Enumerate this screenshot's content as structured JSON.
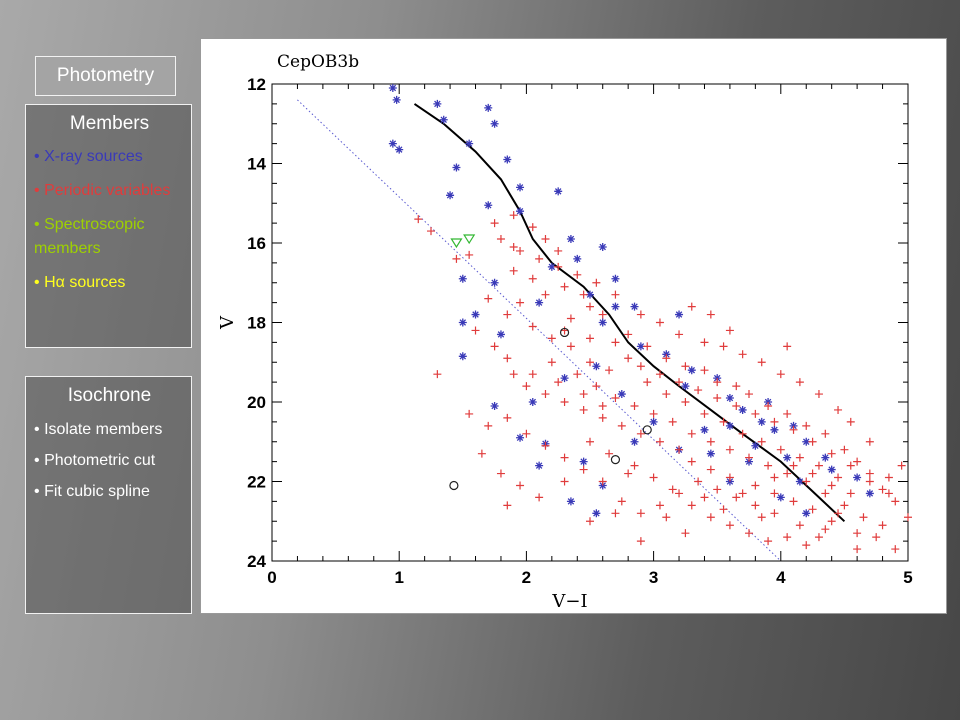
{
  "sidebar": {
    "photometry": "Photometry",
    "members": {
      "title": "Members",
      "items": [
        {
          "bullet": "•",
          "text": "X-ray sources",
          "color": "#3a3ab8"
        },
        {
          "bullet": "•",
          "text": "Periodic variables",
          "color": "#e03c3c"
        },
        {
          "bullet": "•",
          "text": "Spectroscopic members",
          "color": "#9ed100"
        },
        {
          "bullet": "•",
          "text": "Hα sources",
          "color": "#ffff1e"
        }
      ]
    },
    "isochrone": {
      "title": "Isochrone",
      "items": [
        {
          "bullet": "•",
          "text": "Isolate members"
        },
        {
          "bullet": "•",
          "text": "Photometric cut"
        },
        {
          "bullet": "•",
          "text": "Fit cubic spline"
        }
      ]
    }
  },
  "chart_data": {
    "type": "scatter",
    "title": "CepOB3b",
    "xlabel": "V−I",
    "ylabel": "V",
    "xlim": [
      0,
      5
    ],
    "ylim": [
      24,
      12
    ],
    "y_inverted": true,
    "x_ticks": [
      "0",
      "1",
      "2",
      "3",
      "4",
      "5"
    ],
    "y_ticks": [
      "12",
      "14",
      "16",
      "18",
      "20",
      "22",
      "24"
    ],
    "grid": false,
    "series": [
      {
        "marker": "asterisk",
        "color": "#3a3ab8",
        "points": [
          [
            0.95,
            12.1
          ],
          [
            0.98,
            12.4
          ],
          [
            0.95,
            13.5
          ],
          [
            1.0,
            13.65
          ],
          [
            1.3,
            12.5
          ],
          [
            1.35,
            12.9
          ],
          [
            1.45,
            14.1
          ],
          [
            1.7,
            12.6
          ],
          [
            1.75,
            13.0
          ],
          [
            1.55,
            13.5
          ],
          [
            1.85,
            13.9
          ],
          [
            1.95,
            14.6
          ],
          [
            1.4,
            14.8
          ],
          [
            1.7,
            15.05
          ],
          [
            1.95,
            15.2
          ],
          [
            2.25,
            14.7
          ],
          [
            2.35,
            15.9
          ],
          [
            2.4,
            16.4
          ],
          [
            2.6,
            16.1
          ],
          [
            2.7,
            16.9
          ],
          [
            2.2,
            16.6
          ],
          [
            1.75,
            17.0
          ],
          [
            1.5,
            16.9
          ],
          [
            1.6,
            17.8
          ],
          [
            1.8,
            18.3
          ],
          [
            1.5,
            18.0
          ],
          [
            1.5,
            18.85
          ],
          [
            2.1,
            17.5
          ],
          [
            2.5,
            17.3
          ],
          [
            2.7,
            17.6
          ],
          [
            2.85,
            17.6
          ],
          [
            3.2,
            17.8
          ],
          [
            2.6,
            18.0
          ],
          [
            2.9,
            18.6
          ],
          [
            3.1,
            18.8
          ],
          [
            3.3,
            19.2
          ],
          [
            3.5,
            19.4
          ],
          [
            3.6,
            19.9
          ],
          [
            3.7,
            20.2
          ],
          [
            3.85,
            20.5
          ],
          [
            3.95,
            20.7
          ],
          [
            4.1,
            20.6
          ],
          [
            4.2,
            21.0
          ],
          [
            4.35,
            21.4
          ],
          [
            3.6,
            20.6
          ],
          [
            3.4,
            20.7
          ],
          [
            3.8,
            21.1
          ],
          [
            4.05,
            21.4
          ],
          [
            3.2,
            21.2
          ],
          [
            3.0,
            20.5
          ],
          [
            2.75,
            19.8
          ],
          [
            2.55,
            19.1
          ],
          [
            2.3,
            19.4
          ],
          [
            2.05,
            20.0
          ],
          [
            1.95,
            20.9
          ],
          [
            2.1,
            21.6
          ],
          [
            2.45,
            21.5
          ],
          [
            2.6,
            22.1
          ],
          [
            2.35,
            22.5
          ],
          [
            2.55,
            22.8
          ],
          [
            3.45,
            21.3
          ],
          [
            3.6,
            22.0
          ],
          [
            3.75,
            21.5
          ],
          [
            4.0,
            22.4
          ],
          [
            4.15,
            22.0
          ],
          [
            4.4,
            21.7
          ],
          [
            4.6,
            21.9
          ],
          [
            4.7,
            22.3
          ],
          [
            4.2,
            22.8
          ],
          [
            2.85,
            21.0
          ],
          [
            2.15,
            21.05
          ],
          [
            3.25,
            19.6
          ],
          [
            3.9,
            20.0
          ],
          [
            1.75,
            20.1
          ]
        ]
      },
      {
        "marker": "plus",
        "color": "#e03c3c",
        "points": [
          [
            1.75,
            15.5
          ],
          [
            1.9,
            15.3
          ],
          [
            2.05,
            15.6
          ],
          [
            2.15,
            15.9
          ],
          [
            2.25,
            16.2
          ],
          [
            1.9,
            16.1
          ],
          [
            1.8,
            15.9
          ],
          [
            1.55,
            16.3
          ],
          [
            1.45,
            16.4
          ],
          [
            1.9,
            16.7
          ],
          [
            2.05,
            16.9
          ],
          [
            2.3,
            17.1
          ],
          [
            2.45,
            17.3
          ],
          [
            2.5,
            17.6
          ],
          [
            2.6,
            17.8
          ],
          [
            2.35,
            17.9
          ],
          [
            2.15,
            17.3
          ],
          [
            1.95,
            17.5
          ],
          [
            1.85,
            17.8
          ],
          [
            2.05,
            18.1
          ],
          [
            2.3,
            18.2
          ],
          [
            2.5,
            18.4
          ],
          [
            2.7,
            18.5
          ],
          [
            2.8,
            18.3
          ],
          [
            2.95,
            18.6
          ],
          [
            3.1,
            18.9
          ],
          [
            3.25,
            19.1
          ],
          [
            3.4,
            19.2
          ],
          [
            3.5,
            19.5
          ],
          [
            3.65,
            19.6
          ],
          [
            3.75,
            19.8
          ],
          [
            3.9,
            20.1
          ],
          [
            4.05,
            20.3
          ],
          [
            4.2,
            20.6
          ],
          [
            4.35,
            20.8
          ],
          [
            4.5,
            21.2
          ],
          [
            4.6,
            21.5
          ],
          [
            4.7,
            21.8
          ],
          [
            4.8,
            22.2
          ],
          [
            4.9,
            22.5
          ],
          [
            4.55,
            22.3
          ],
          [
            4.4,
            22.1
          ],
          [
            4.25,
            21.8
          ],
          [
            4.1,
            21.6
          ],
          [
            3.95,
            21.9
          ],
          [
            3.8,
            22.1
          ],
          [
            3.6,
            21.9
          ],
          [
            3.45,
            21.7
          ],
          [
            3.3,
            21.5
          ],
          [
            3.2,
            21.2
          ],
          [
            3.05,
            21.0
          ],
          [
            2.9,
            20.8
          ],
          [
            2.75,
            20.6
          ],
          [
            2.6,
            20.4
          ],
          [
            2.45,
            20.2
          ],
          [
            2.3,
            20.0
          ],
          [
            2.15,
            19.8
          ],
          [
            2.0,
            19.6
          ],
          [
            1.9,
            19.3
          ],
          [
            1.85,
            18.9
          ],
          [
            2.2,
            19.0
          ],
          [
            2.4,
            19.3
          ],
          [
            2.55,
            19.6
          ],
          [
            2.7,
            19.9
          ],
          [
            2.85,
            20.1
          ],
          [
            3.0,
            20.3
          ],
          [
            3.15,
            20.5
          ],
          [
            3.3,
            20.8
          ],
          [
            3.45,
            21.0
          ],
          [
            3.6,
            21.2
          ],
          [
            3.75,
            21.4
          ],
          [
            3.9,
            21.6
          ],
          [
            4.05,
            21.8
          ],
          [
            4.2,
            22.0
          ],
          [
            4.35,
            22.3
          ],
          [
            4.5,
            22.6
          ],
          [
            4.65,
            22.9
          ],
          [
            4.8,
            23.1
          ],
          [
            4.6,
            23.3
          ],
          [
            4.4,
            23.0
          ],
          [
            4.25,
            22.7
          ],
          [
            4.1,
            22.5
          ],
          [
            3.95,
            22.3
          ],
          [
            3.8,
            22.6
          ],
          [
            3.65,
            22.4
          ],
          [
            3.5,
            22.2
          ],
          [
            3.35,
            22.0
          ],
          [
            3.2,
            22.3
          ],
          [
            3.05,
            22.6
          ],
          [
            2.9,
            22.8
          ],
          [
            2.75,
            22.5
          ],
          [
            2.6,
            22.0
          ],
          [
            2.45,
            21.7
          ],
          [
            2.3,
            21.4
          ],
          [
            2.15,
            21.1
          ],
          [
            2.0,
            20.8
          ],
          [
            1.85,
            20.4
          ],
          [
            1.7,
            20.6
          ],
          [
            1.65,
            21.3
          ],
          [
            1.8,
            21.8
          ],
          [
            1.95,
            22.1
          ],
          [
            2.1,
            22.4
          ],
          [
            2.3,
            22.0
          ],
          [
            2.5,
            21.0
          ],
          [
            2.65,
            21.3
          ],
          [
            2.85,
            21.6
          ],
          [
            3.0,
            21.9
          ],
          [
            3.15,
            22.2
          ],
          [
            3.3,
            22.6
          ],
          [
            3.45,
            22.9
          ],
          [
            3.6,
            23.1
          ],
          [
            3.75,
            23.3
          ],
          [
            3.9,
            23.5
          ],
          [
            4.05,
            23.4
          ],
          [
            4.2,
            23.6
          ],
          [
            4.35,
            23.2
          ],
          [
            4.6,
            23.7
          ],
          [
            4.75,
            23.4
          ],
          [
            4.9,
            23.7
          ],
          [
            5.0,
            22.9
          ],
          [
            4.85,
            21.9
          ],
          [
            4.7,
            21.0
          ],
          [
            4.55,
            20.5
          ],
          [
            4.45,
            20.2
          ],
          [
            4.3,
            19.8
          ],
          [
            4.15,
            19.5
          ],
          [
            4.0,
            19.3
          ],
          [
            3.85,
            19.0
          ],
          [
            3.7,
            18.8
          ],
          [
            3.55,
            18.6
          ],
          [
            3.4,
            18.5
          ],
          [
            3.2,
            18.3
          ],
          [
            3.05,
            18.0
          ],
          [
            2.9,
            17.8
          ],
          [
            2.7,
            17.3
          ],
          [
            2.55,
            17.0
          ],
          [
            2.4,
            16.8
          ],
          [
            2.25,
            16.6
          ],
          [
            2.1,
            16.4
          ],
          [
            1.95,
            16.2
          ],
          [
            1.7,
            17.4
          ],
          [
            1.6,
            18.2
          ],
          [
            1.75,
            18.6
          ],
          [
            2.05,
            19.3
          ],
          [
            2.25,
            19.5
          ],
          [
            2.45,
            19.8
          ],
          [
            2.6,
            20.1
          ],
          [
            2.95,
            19.5
          ],
          [
            3.1,
            19.8
          ],
          [
            3.25,
            20.0
          ],
          [
            3.4,
            20.3
          ],
          [
            3.55,
            20.5
          ],
          [
            3.7,
            20.8
          ],
          [
            3.85,
            21.0
          ],
          [
            4.0,
            21.2
          ],
          [
            4.15,
            21.4
          ],
          [
            4.3,
            21.6
          ],
          [
            4.45,
            21.9
          ],
          [
            1.3,
            19.3
          ],
          [
            1.15,
            15.4
          ],
          [
            1.25,
            15.7
          ],
          [
            1.55,
            20.3
          ],
          [
            1.85,
            22.6
          ],
          [
            2.5,
            23.0
          ],
          [
            2.9,
            23.5
          ],
          [
            3.25,
            23.3
          ],
          [
            3.55,
            22.7
          ],
          [
            3.85,
            22.9
          ],
          [
            4.05,
            18.6
          ],
          [
            3.6,
            18.2
          ],
          [
            3.45,
            17.8
          ],
          [
            3.3,
            17.6
          ],
          [
            2.8,
            18.9
          ],
          [
            2.65,
            19.2
          ],
          [
            2.5,
            19.0
          ],
          [
            2.35,
            18.6
          ],
          [
            2.2,
            18.4
          ],
          [
            2.9,
            19.1
          ],
          [
            3.05,
            19.3
          ],
          [
            3.2,
            19.5
          ],
          [
            3.35,
            19.7
          ],
          [
            3.5,
            19.9
          ],
          [
            3.65,
            20.1
          ],
          [
            3.8,
            20.3
          ],
          [
            3.95,
            20.5
          ],
          [
            4.1,
            20.7
          ],
          [
            4.25,
            21.0
          ],
          [
            4.4,
            21.3
          ],
          [
            4.55,
            21.6
          ],
          [
            4.7,
            22.0
          ],
          [
            4.85,
            22.3
          ],
          [
            4.95,
            21.6
          ],
          [
            4.45,
            22.8
          ],
          [
            4.3,
            23.4
          ],
          [
            4.15,
            23.1
          ],
          [
            3.95,
            22.8
          ],
          [
            3.7,
            22.3
          ],
          [
            3.4,
            22.4
          ],
          [
            3.1,
            22.9
          ],
          [
            2.8,
            21.8
          ],
          [
            2.7,
            22.8
          ]
        ]
      },
      {
        "marker": "triangle-down",
        "color": "#33b833",
        "points": [
          [
            1.55,
            15.9
          ],
          [
            1.45,
            16.0
          ]
        ]
      },
      {
        "marker": "circle",
        "color": "#222222",
        "points": [
          [
            1.43,
            22.1
          ],
          [
            2.7,
            21.45
          ],
          [
            2.95,
            20.7
          ],
          [
            2.3,
            18.25
          ]
        ]
      }
    ],
    "lines": [
      {
        "name": "isochrone",
        "style": "solid",
        "color": "#000000",
        "points": [
          [
            1.12,
            12.5
          ],
          [
            1.35,
            13.0
          ],
          [
            1.6,
            13.7
          ],
          [
            1.8,
            14.4
          ],
          [
            1.95,
            15.2
          ],
          [
            2.05,
            15.9
          ],
          [
            2.2,
            16.5
          ],
          [
            2.45,
            17.1
          ],
          [
            2.65,
            17.8
          ],
          [
            2.8,
            18.5
          ],
          [
            3.0,
            19.1
          ],
          [
            3.2,
            19.6
          ],
          [
            3.45,
            20.2
          ],
          [
            3.7,
            20.8
          ],
          [
            4.0,
            21.5
          ],
          [
            4.3,
            22.4
          ],
          [
            4.5,
            23.0
          ]
        ]
      },
      {
        "name": "photometric-cut",
        "style": "dotted",
        "color": "#5a5ad0",
        "points": [
          [
            0.2,
            12.4
          ],
          [
            4.0,
            24.0
          ]
        ]
      }
    ]
  }
}
